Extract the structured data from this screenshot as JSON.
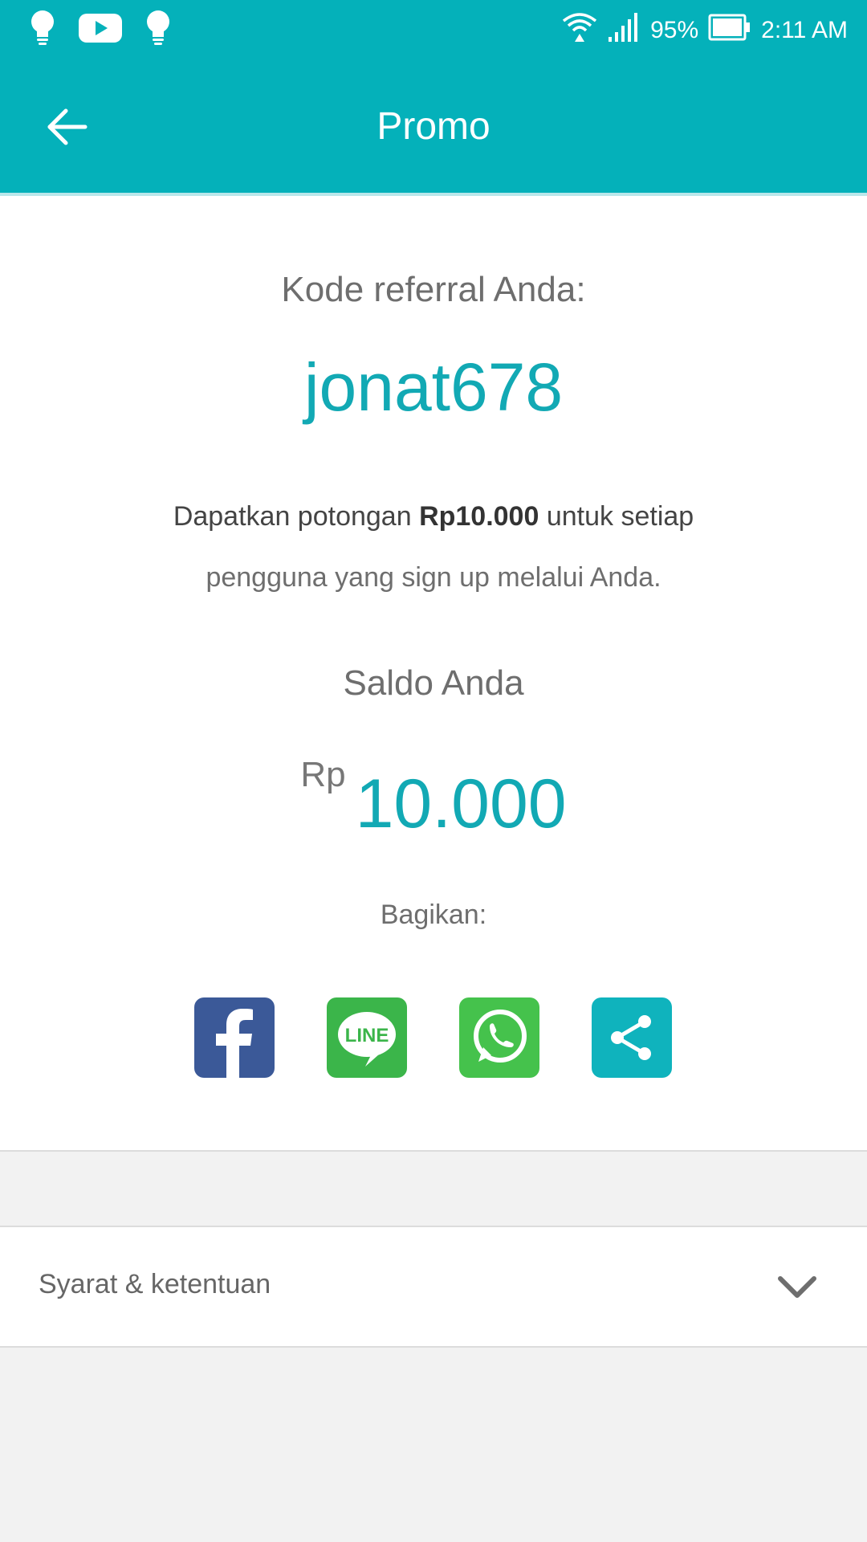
{
  "status_bar": {
    "notification_icons": [
      "lightbulb-icon",
      "youtube-icon",
      "lightbulb-icon"
    ],
    "battery": "95%",
    "time": "2:11 AM"
  },
  "app_bar": {
    "title": "Promo",
    "back_icon": "arrow-left-icon"
  },
  "referral": {
    "label": "Kode referral Anda:",
    "code": "jonat678"
  },
  "description": {
    "prefix": "Dapatkan potongan ",
    "amount": "Rp10.000",
    "suffix": " untuk setiap",
    "line2": "pengguna yang sign up melalui Anda."
  },
  "balance": {
    "label": "Saldo Anda",
    "currency": "Rp",
    "amount": "10.000"
  },
  "share": {
    "label": "Bagikan:",
    "buttons": [
      {
        "name": "facebook",
        "icon": "facebook-icon",
        "color": "#3b5998"
      },
      {
        "name": "line",
        "icon": "line-icon",
        "text": "LINE",
        "color": "#3bb54a"
      },
      {
        "name": "whatsapp",
        "icon": "whatsapp-icon",
        "color": "#45c24c"
      },
      {
        "name": "share",
        "icon": "share-icon",
        "color": "#0fb3bd"
      }
    ]
  },
  "terms": {
    "label": "Syarat & ketentuan",
    "icon": "chevron-down-icon"
  },
  "colors": {
    "primary": "#04b1ba",
    "accent_text": "#12a9b4",
    "background": "#f2f2f2"
  }
}
